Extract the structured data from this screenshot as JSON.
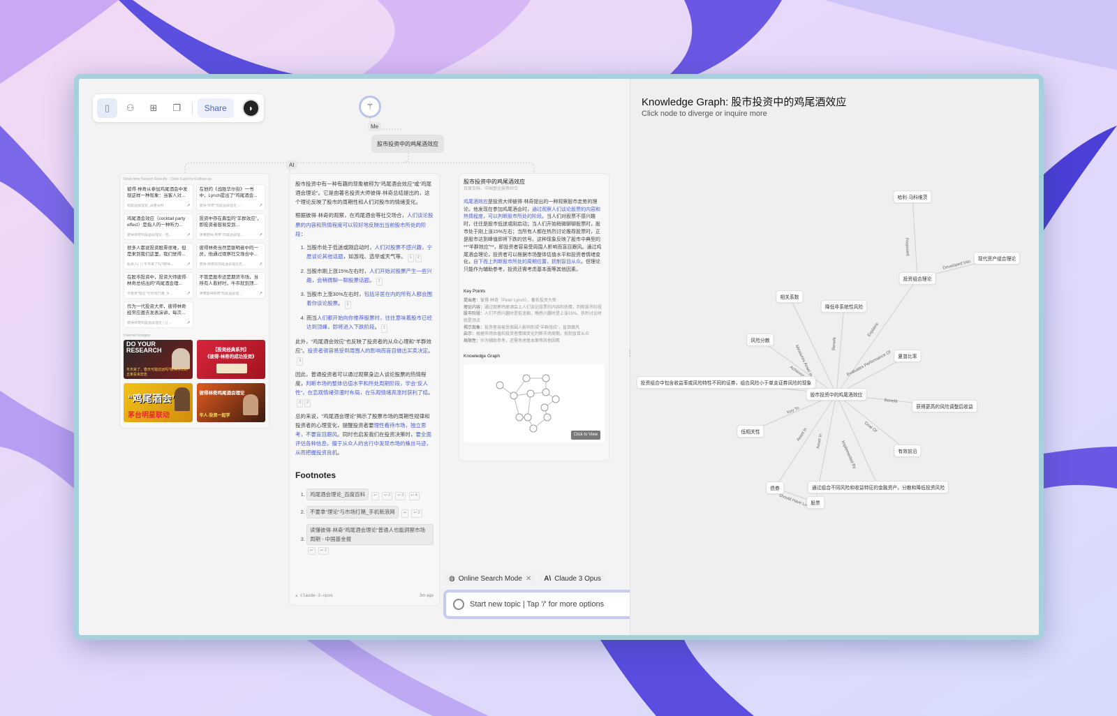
{
  "toolbar": {
    "share_label": "Share"
  },
  "thread": {
    "me_label": "Me",
    "ai_label": "AI",
    "question": "股市投资中的鸡尾酒效应"
  },
  "search": {
    "title": "Real-time Search Results · Click Card for Follow-up",
    "results": [
      {
        "text": "彼得·林奇从参加鸡尾酒会中发现这样一种现象：当客人对...",
        "src": "鸡尾酒会理论_百度百科"
      },
      {
        "text": "在他的《战胜华尔街》一书中，Lynch提出了“鸡尾酒会...",
        "src": "彼得·林奇“鸡尾酒会理论 -..."
      },
      {
        "text": "鸡尾酒会效应（cocktail party effect）是指人的一种听力...",
        "src": "彼得林奇鸡尾酒会理论 - 雪..."
      },
      {
        "text": "投资中存在典型的“羊群效应”，即投资者容易受到...",
        "src": "读懂彼得·林奇“鸡尾酒会理..."
      },
      {
        "text": "很多人都说投资股票很难，但是来到我们这里，我们觉得...",
        "src": "股票入门 | 牛市来了吗?彼得..."
      },
      {
        "text": "彼得林奇当然是聪明者中的一员，他通过观察社交场合中...",
        "src": "彼得·林奇的鸡尾酒会理论告..."
      },
      {
        "text": "在股市投资中，投资大师彼得·林奇总结出的“鸡尾酒会理...",
        "src": "不要拿“理论”与市场打赌_手..."
      },
      {
        "text": "不管是股市还是期货市场，当所有人看好时，牛市就到顶...",
        "src": "读懂彼得林奇“鸡尾酒会理..."
      },
      {
        "text": "作为一代投资大师，彼得林奇经常应邀去发表演讲，每次...",
        "src": "彼得林奇鸡尾酒会理论 | 让..."
      }
    ],
    "images_title": "Internet Images",
    "images": [
      {
        "line1": "DO YOUR RESEARCH",
        "line2": "冬天来了，春天可能还远吗?彼得林奇的五条投资忠告"
      },
      {
        "line1": "【投资经典系列】",
        "line2": "《彼得·林奇的成功投资》"
      },
      {
        "line1": "“鸡尾酒会”",
        "line2": "茅台明星联动"
      },
      {
        "line1": "彼得林奇鸡尾酒会理论",
        "line2": "华人·投资一起学"
      }
    ]
  },
  "answer": {
    "p1": "股市投资中有一种有趣的现象被称为“鸡尾酒会效应”或“鸡尾酒会理论”。它是由著名投资大师彼得·林奇总结提出的，这个理论反映了股市的周期性和人们对股市的情绪变化。",
    "p2a": "根据彼得·林奇的观察，在鸡尾酒会等社交场合，",
    "p2b": "人们谈论股票的内容和热情程度可以较好地反映出当前股市所处的阶段",
    "p2c": "：",
    "list": [
      {
        "a": "当股市处于低迷或刚启动时，",
        "b": "人们对股票不感兴趣，宁愿谈论其他话题",
        "c": "，如游戏、选举或天气等。",
        "refs": [
          "1",
          "2"
        ]
      },
      {
        "a": "当股市刚上涨15%左右时，",
        "b": "人们开始对股票产生一些兴趣，会稍微聊一聊股票话题",
        "c": "。",
        "refs": [
          "1"
        ]
      },
      {
        "a": "当股市上涨30%左右时，",
        "b": "包括牙医在内的所有人都会围着你谈论股票",
        "c": "。",
        "refs": [
          "1"
        ]
      },
      {
        "a": "而当",
        "b": "人们都开始向你推荐股票时，往往意味着股市已经达到顶峰，即将进入下跌阶段",
        "c": "。",
        "refs": [
          "1"
        ]
      }
    ],
    "p3a": "此外，“鸡尾酒会效应”也反映了投资者的从众心理和“羊群效应”。",
    "p3b": "投资者很容易受到周围人的影响而盲目做出买卖决定",
    "p3c": "。",
    "p3ref": "3",
    "p4a": "因此，普通投资者可以通过观察身边人谈论股票的热情程度，",
    "p4b": "判断市场的整体估值水平和所处周期阶段，学会“反人性”，在恋观情绪弥漫时布局，在乐观情绪高涨时获利了结",
    "p4c": "。",
    "p4refs": [
      "3",
      "2"
    ],
    "p5a": "总的来说，“鸡尾酒会理论”揭示了股票市场的周期性规律和投资者的心理变化，提醒投资者要",
    "p5b": "理性看待市场，独立思考，不要盲目跟风",
    "p5c": "。同时也启发我们在投资决策时，",
    "p5d": "要全面评估各种信息，擅于从众人的言行中发现市场的蛛丝马迹，从而把握投资良机",
    "p5e": "。",
    "footnotes_title": "Footnotes",
    "footnotes": [
      {
        "text": "鸡尾酒会理论_百度百科",
        "refs": [
          "↩",
          "↩ 2",
          "↩ 3",
          "↩ 4"
        ]
      },
      {
        "text": "不要拿“理论”与市场打赌_手机新浪网",
        "refs": [
          "↩",
          "↩ 2"
        ]
      },
      {
        "text": "读懂彼得·林奇“鸡尾酒会理论”普通人也能洞察市场周期 - 中国基金报",
        "refs": [
          "↩",
          "↩ 2"
        ]
      }
    ],
    "model": "claude-3-opus",
    "ago": "3m ago"
  },
  "knowledge_card": {
    "title": "股市投资中的鸡尾酒效应",
    "sources": "百度百科、中国基金报等综合",
    "body_a": "鸡尾酒效应",
    "body_b": "是投资大师彼得·林奇提出的一种观察股市走势的理论。他发现在参加鸡尾酒会时，",
    "body_c": "通过观察人们谈论股票的内容和热情程度，可以判断股市所处的阶段",
    "body_d": "。当人们对股票不感兴趣时，往往是股市低迷或刚启动；当人们开始稍微聊聊股票时，股市处于刚上涨15%左右；当所有人都在热烈讨论推荐股票时，正是股市达到峰值即将下跌的信号。这种现象反映了股市中典型的**“羊群效应”**，即投资者容易受周围人影响而盲目跟风。通过鸡尾酒会理论，投资者可以根据市场整体估值水平和投资者情绪变化，",
    "body_e": "自下而上判断股市所处的周期位置，抓制盲目从众",
    "body_f": "。但理论只能作为辅助参考，投资还需考虑基本面等其他因素。",
    "key_points_title": "Key Points",
    "key_points": [
      {
        "k": "提出者：",
        "v": "彼得·林奇（Peter Lynch），著名投资大师"
      },
      {
        "k": "理论内容：",
        "v": "通过观察鸡尾酒会上人们谈论股票的内容和热情，判断股市阶段"
      },
      {
        "k": "股市阶段：",
        "v": "人们不感兴趣时是低迷期，略感兴趣时是上涨15%，热烈讨论时就是顶点"
      },
      {
        "k": "揭示现象：",
        "v": "投资者容易受周围人影响形成“羊群效应”，盲目跟风"
      },
      {
        "k": "启示：",
        "v": "根据市场估值和投资者情绪变化判断市场周期，抵制盲目从众"
      },
      {
        "k": "局限性：",
        "v": "作为辅助参考，还需考虑基本面等其他因素"
      }
    ],
    "kg_title": "Knowledge Graph",
    "click_to_view": "Click to View"
  },
  "input": {
    "online_mode": "Online Search Mode",
    "model": "Claude 3 Opus",
    "placeholder": "Start new topic | Tap '/' for more options"
  },
  "graph": {
    "title": "Knowledge Graph: 股市投资中的鸡尾酒效应",
    "subtitle": "Click node to diverge or inquire more",
    "nodes": [
      {
        "id": "center",
        "label": "股市投资中的鸡尾酒效应"
      },
      {
        "id": "harry",
        "label": "哈利·马科维茨"
      },
      {
        "id": "mpt",
        "label": "现代资产组合理论"
      },
      {
        "id": "portfolio",
        "label": "投资组合理论"
      },
      {
        "id": "corr",
        "label": "相关系数"
      },
      {
        "id": "reduce",
        "label": "降低非系统性风险"
      },
      {
        "id": "dispersion",
        "label": "风险分散"
      },
      {
        "id": "sharpe",
        "label": "夏普比率"
      },
      {
        "id": "effect",
        "label": "投资组合中包含收益率或风险特性不同的证券，组合风险小于单支证券风险的现象"
      },
      {
        "id": "better",
        "label": "获得更高的风险调整后收益"
      },
      {
        "id": "lowcorr",
        "label": "低相关性"
      },
      {
        "id": "frontier",
        "label": "有效前沿"
      },
      {
        "id": "bond",
        "label": "债券"
      },
      {
        "id": "stock",
        "label": "股票"
      },
      {
        "id": "method",
        "label": "通过组合不同风险和收益特征的金融资产，分散和降低投资风险"
      }
    ],
    "edges": [
      {
        "from": "harry",
        "to": "portfolio",
        "label": "Proposed"
      },
      {
        "from": "portfolio",
        "to": "mpt",
        "label": "Developed Into"
      },
      {
        "from": "center",
        "to": "portfolio",
        "label": "Explains"
      },
      {
        "from": "center",
        "to": "corr",
        "label": "Measures Asset In"
      },
      {
        "from": "center",
        "to": "reduce",
        "label": "Benefit"
      },
      {
        "from": "center",
        "to": "dispersion",
        "label": "Achieves"
      },
      {
        "from": "center",
        "to": "sharpe",
        "label": "Evaluates Performance Of"
      },
      {
        "from": "center",
        "to": "effect",
        "label": ""
      },
      {
        "from": "center",
        "to": "better",
        "label": "Benefit"
      },
      {
        "from": "center",
        "to": "lowcorr",
        "label": "Key To"
      },
      {
        "from": "center",
        "to": "frontier",
        "label": "Goal Of"
      },
      {
        "from": "center",
        "to": "bond",
        "label": "Asset In"
      },
      {
        "from": "center",
        "to": "stock",
        "label": "Asset In"
      },
      {
        "from": "center",
        "to": "method",
        "label": "Implemented By"
      },
      {
        "from": "bond",
        "to": "stock",
        "label": "Should Have Low"
      }
    ]
  },
  "colors": {
    "accent": "#4d5fd4",
    "frame": "#a7d0dd",
    "input_border": "#c7cbf2"
  }
}
